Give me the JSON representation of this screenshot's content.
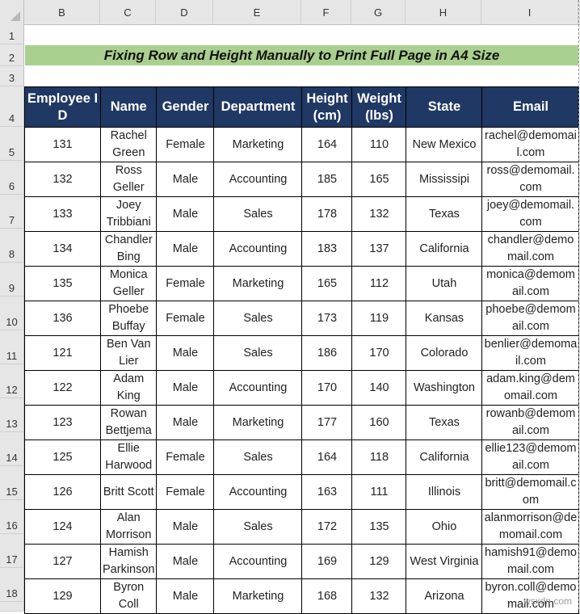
{
  "spreadsheet": {
    "columns": [
      "B",
      "C",
      "D",
      "E",
      "F",
      "G",
      "H",
      "I"
    ],
    "rows": [
      "1",
      "2",
      "3",
      "4",
      "5",
      "6",
      "7",
      "8",
      "9",
      "10",
      "11",
      "12",
      "13",
      "14",
      "15",
      "16",
      "17",
      "18"
    ],
    "title": "Fixing Row and Height Manually to Print Full Page in A4 Size",
    "title_fill": "#a9d08e",
    "header_fill": "#203864",
    "table": {
      "headers": [
        "Employee ID",
        "Name",
        "Gender",
        "Department",
        "Height (cm)",
        "Weight (lbs)",
        "State",
        "Email"
      ],
      "rows": [
        [
          "131",
          "Rachel Green",
          "Female",
          "Marketing",
          "164",
          "110",
          "New Mexico",
          "rachel@demomail.com"
        ],
        [
          "132",
          "Ross Geller",
          "Male",
          "Accounting",
          "185",
          "165",
          "Mississipi",
          "ross@demomail.com"
        ],
        [
          "133",
          "Joey Tribbiani",
          "Male",
          "Sales",
          "178",
          "132",
          "Texas",
          "joey@demomail.com"
        ],
        [
          "134",
          "Chandler Bing",
          "Male",
          "Accounting",
          "183",
          "137",
          "California",
          "chandler@demomail.com"
        ],
        [
          "135",
          "Monica Geller",
          "Female",
          "Marketing",
          "165",
          "112",
          "Utah",
          "monica@demomail.com"
        ],
        [
          "136",
          "Phoebe Buffay",
          "Female",
          "Sales",
          "173",
          "119",
          "Kansas",
          "phoebe@demomail.com"
        ],
        [
          "121",
          "Ben Van Lier",
          "Male",
          "Sales",
          "186",
          "170",
          "Colorado",
          "benlier@demomail.com"
        ],
        [
          "122",
          "Adam King",
          "Male",
          "Accounting",
          "170",
          "140",
          "Washington",
          "adam.king@demomail.com"
        ],
        [
          "123",
          "Rowan Bettjema",
          "Male",
          "Marketing",
          "177",
          "160",
          "Texas",
          "rowanb@demomail.com"
        ],
        [
          "125",
          "Ellie Harwood",
          "Female",
          "Sales",
          "164",
          "118",
          "California",
          "ellie123@demomail.com"
        ],
        [
          "126",
          "Britt Scott",
          "Female",
          "Accounting",
          "163",
          "111",
          "Illinois",
          "britt@demomail.com"
        ],
        [
          "124",
          "Alan Morrison",
          "Male",
          "Sales",
          "172",
          "135",
          "Ohio",
          "alanmorrison@demomail.com"
        ],
        [
          "127",
          "Hamish Parkinson",
          "Male",
          "Accounting",
          "169",
          "129",
          "West Virginia",
          "hamish91@demomail.com"
        ],
        [
          "129",
          "Byron Coll",
          "Male",
          "Marketing",
          "168",
          "132",
          "Arizona",
          "byron.coll@demomail.com"
        ]
      ]
    }
  },
  "watermark": "wsxdn.com"
}
